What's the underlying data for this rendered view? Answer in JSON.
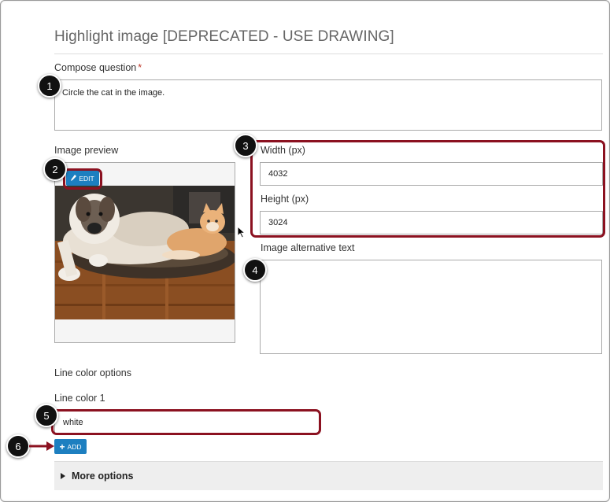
{
  "form": {
    "title": "Highlight image [DEPRECATED - USE DRAWING]",
    "compose_label": "Compose question",
    "required_marker": "*",
    "compose_value": "Circle the cat in the image.",
    "image_preview_label": "Image preview",
    "edit_button": "EDIT",
    "width_label": "Width (px)",
    "width_value": "4032",
    "height_label": "Height (px)",
    "height_value": "3024",
    "alt_text_label": "Image alternative text",
    "alt_text_value": "",
    "line_color_options_label": "Line color options",
    "line_color_1_label": "Line color 1",
    "line_color_1_value": "white",
    "add_button": "ADD",
    "more_options": "More options"
  },
  "annotations": {
    "badges": [
      "1",
      "2",
      "3",
      "4",
      "5",
      "6"
    ],
    "highlight_color": "#8b1120"
  },
  "icons": {
    "edit": "pencil-icon",
    "add": "plus-icon",
    "expand": "triangle-right-icon",
    "pointer": "mouse-cursor-icon"
  },
  "colors": {
    "button": "#1d7fc0",
    "title": "#666666",
    "panel": "#eeeeee"
  }
}
